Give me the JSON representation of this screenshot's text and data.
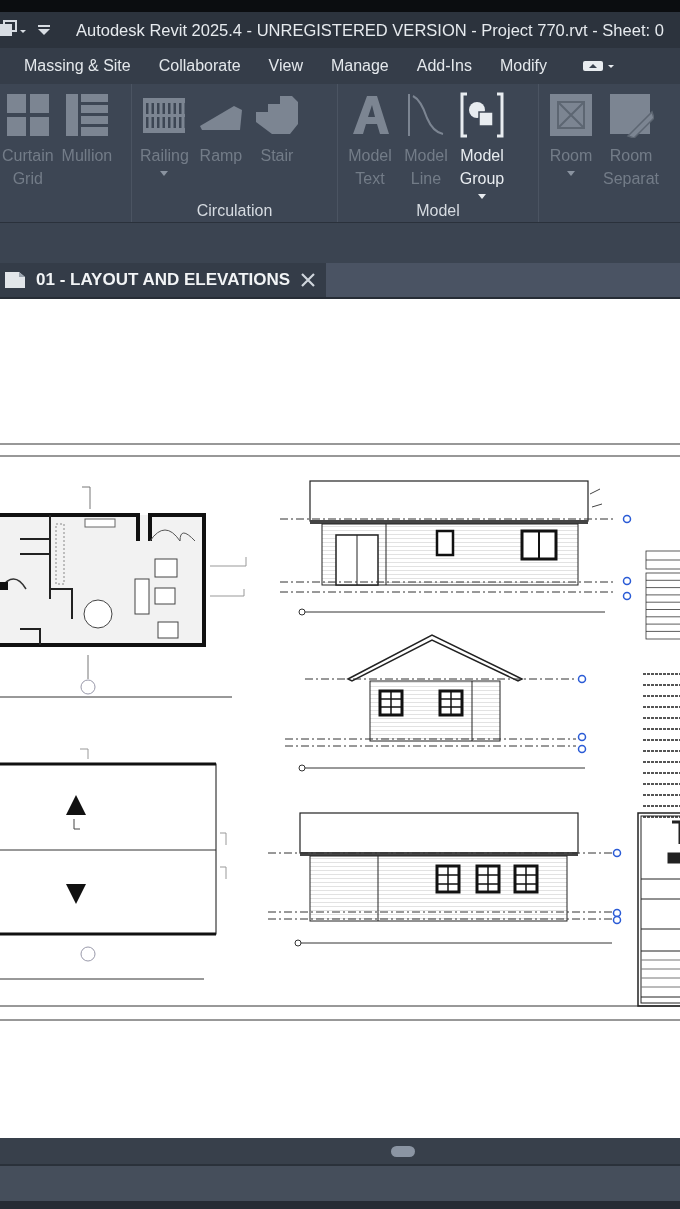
{
  "window": {
    "title": "Autodesk Revit 2025.4 - UNREGISTERED VERSION - Project 770.rvt - Sheet: 0"
  },
  "ribbon_tabs": [
    {
      "label": "Massing & Site"
    },
    {
      "label": "Collaborate"
    },
    {
      "label": "View"
    },
    {
      "label": "Manage"
    },
    {
      "label": "Add-Ins"
    },
    {
      "label": "Modify"
    }
  ],
  "ribbon_panels": [
    {
      "items": [
        {
          "kind": "curtain-grid",
          "label": "Curtain Grid",
          "disabled": true,
          "dropdown": false
        },
        {
          "kind": "mullion",
          "label": "Mullion",
          "disabled": true,
          "dropdown": false
        }
      ]
    },
    {
      "title": "Circulation",
      "items": [
        {
          "kind": "railing",
          "label": "Railing",
          "disabled": true,
          "dropdown": true
        },
        {
          "kind": "ramp",
          "label": "Ramp",
          "disabled": true,
          "dropdown": false
        },
        {
          "kind": "stair",
          "label": "Stair",
          "disabled": true,
          "dropdown": false
        }
      ]
    },
    {
      "title": "Model",
      "items": [
        {
          "kind": "model-text",
          "label": "Model Text",
          "disabled": true,
          "dropdown": false
        },
        {
          "kind": "model-line",
          "label": "Model Line",
          "disabled": true,
          "dropdown": false
        },
        {
          "kind": "model-group",
          "label": "Model Group",
          "disabled": false,
          "dropdown": true
        }
      ]
    },
    {
      "items": [
        {
          "kind": "room",
          "label": "Room",
          "disabled": true,
          "dropdown": true
        },
        {
          "kind": "room-separator",
          "label": "Room Separat",
          "disabled": true,
          "dropdown": false
        }
      ]
    }
  ],
  "document_tab": {
    "label": "01 - LAYOUT AND ELEVATIONS"
  }
}
